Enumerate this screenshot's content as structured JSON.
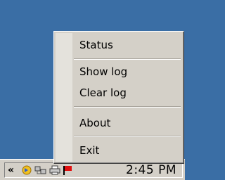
{
  "menu": {
    "items": [
      {
        "label": "Status"
      },
      {
        "label": "Show log"
      },
      {
        "label": "Clear log"
      },
      {
        "label": "About"
      },
      {
        "label": "Exit"
      }
    ]
  },
  "taskbar": {
    "tray_arrow": "«",
    "clock": "2:45 PM",
    "tray_icons": [
      "sync-icon",
      "network-icon",
      "printer-icon",
      "flag-icon"
    ]
  }
}
